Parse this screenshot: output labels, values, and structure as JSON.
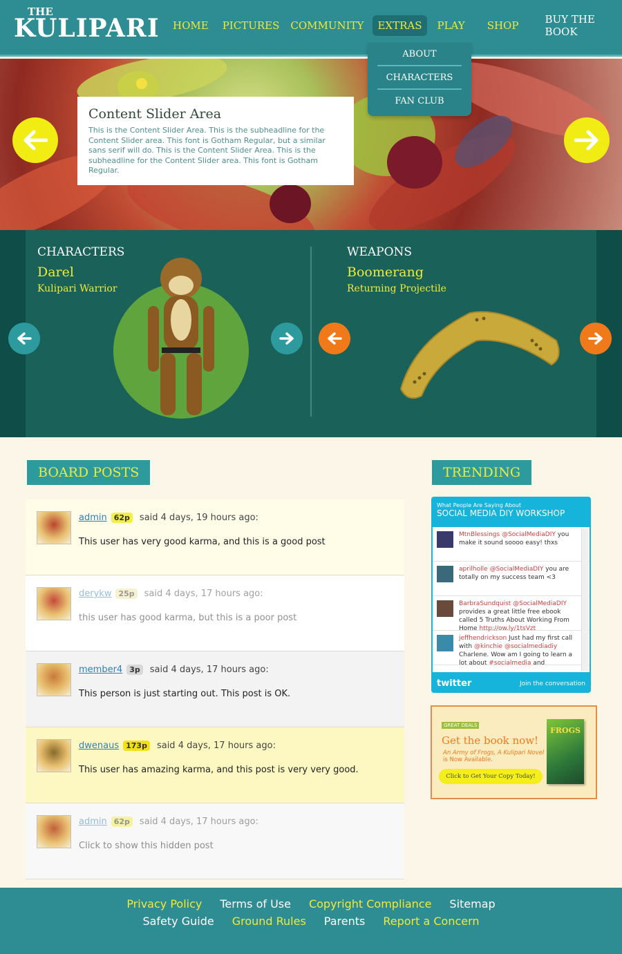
{
  "brand": {
    "the": "THE",
    "name": "KULIPARI"
  },
  "nav": [
    {
      "label": "HOME",
      "style": "yellow"
    },
    {
      "label": "PICTURES",
      "style": "yellow"
    },
    {
      "label": "COMMUNITY",
      "style": "yellow"
    },
    {
      "label": "EXTRAS",
      "style": "active"
    },
    {
      "label": "PLAY",
      "style": "yellow"
    },
    {
      "label": "SHOP",
      "style": "yellow"
    },
    {
      "label": "BUY THE BOOK",
      "style": "white"
    }
  ],
  "extras_menu": [
    "ABOUT",
    "CHARACTERS",
    "FAN CLUB"
  ],
  "hero": {
    "title": "Content Slider Area",
    "body": "This is the Content Slider Area. This is the subheadline for the Content Slider area. This font is Gotham Regular, but a similar sans serif will do. This is the Content Slider Area. This is the subheadline for the Content Slider area. This font is Gotham Regular."
  },
  "characters": {
    "section": "CHARACTERS",
    "name": "Darel",
    "subtitle": "Kulipari Warrior"
  },
  "weapons": {
    "section": "WEAPONS",
    "name": "Boomerang",
    "subtitle": "Returning Projectile"
  },
  "board_posts": {
    "label": "BOARD POSTS",
    "posts": [
      {
        "user": "admin",
        "karma": "62p",
        "ago": "said 4 days, 19 hours ago:",
        "text": "This user has very good karma, and this is a good post",
        "bg": "#fffde8",
        "faded": false,
        "karma_bg": "#f4ee4a"
      },
      {
        "user": "derykw",
        "karma": "25p",
        "ago": "said 4 days, 17 hours ago:",
        "text": "this user has good karma, but this is a poor post",
        "bg": "#ffffff",
        "faded": true,
        "karma_bg": "#f2e5a0"
      },
      {
        "user": "member4",
        "karma": "3p",
        "ago": "said 4 days, 17 hours ago:",
        "text": "This person is just starting out. This post is OK.",
        "bg": "#f3f3f3",
        "faded": false,
        "karma_bg": "#d8d8d8"
      },
      {
        "user": "dwenaus",
        "karma": "173p",
        "ago": "said 4 days, 17 hours ago:",
        "text": "This user has amazing karma, and this post is very very good.",
        "bg": "#fdf8c2",
        "faded": false,
        "karma_bg": "#f4e01a"
      },
      {
        "user": "admin",
        "karma": "62p",
        "ago": "said 4 days, 17 hours ago:",
        "text": "Click to show this hidden post",
        "bg": "#f8f8f8",
        "faded": true,
        "karma_bg": "#f4ee4a"
      }
    ]
  },
  "trending": {
    "label": "TRENDING",
    "widget": {
      "small": "What People Are Saying About",
      "big": "SOCIAL MEDIA DIY WORKSHOP",
      "logo": "twitter",
      "join": "Join the conversation",
      "tweets": [
        {
          "parts": [
            {
              "t": "MtnBlessings",
              "c": "h"
            },
            {
              "t": " "
            },
            {
              "t": "@SocialMediaDIY",
              "c": "h"
            },
            {
              "t": " you make it sound soooo easy! thxs"
            }
          ]
        },
        {
          "parts": [
            {
              "t": "aprilholle",
              "c": "h"
            },
            {
              "t": " "
            },
            {
              "t": "@SocialMediaDIY",
              "c": "h"
            },
            {
              "t": " you are totally on my success team <3"
            }
          ]
        },
        {
          "parts": [
            {
              "t": "BarbraSundquist",
              "c": "h"
            },
            {
              "t": " "
            },
            {
              "t": "@SocialMediaDIY",
              "c": "h"
            },
            {
              "t": " provides a great little free ebook called 5 Truths About Working From Home "
            },
            {
              "t": "http://ow.ly/1tsVzt",
              "c": "h"
            }
          ]
        },
        {
          "parts": [
            {
              "t": "jeffhendrickson",
              "c": "h"
            },
            {
              "t": " Just had my first call with "
            },
            {
              "t": "@kinchie",
              "c": "h"
            },
            {
              "t": " "
            },
            {
              "t": "@socialmediadiy",
              "c": "h"
            },
            {
              "t": " Charlene. Wow am I going to learn a lot about "
            },
            {
              "t": "#socialmedia",
              "c": "h"
            },
            {
              "t": " and"
            }
          ]
        }
      ]
    }
  },
  "ad": {
    "badge": "GREAT DEALS",
    "title": "Get the book now!",
    "sub_italic": "An Army of Frogs, A Kulipari Novel",
    "sub_rest": " is Now Available.",
    "cta": "Click to Get Your Copy Today!",
    "book_title": "FROGS"
  },
  "footer": {
    "row1": [
      {
        "label": "Privacy Policy",
        "color": "y"
      },
      {
        "label": "Terms of Use",
        "color": "w"
      },
      {
        "label": "Copyright Compliance",
        "color": "y"
      },
      {
        "label": "Sitemap",
        "color": "w"
      }
    ],
    "row2": [
      {
        "label": "Safety Guide",
        "color": "w"
      },
      {
        "label": "Ground Rules",
        "color": "y"
      },
      {
        "label": "Parents",
        "color": "w"
      },
      {
        "label": "Report a Concern",
        "color": "y"
      }
    ]
  }
}
